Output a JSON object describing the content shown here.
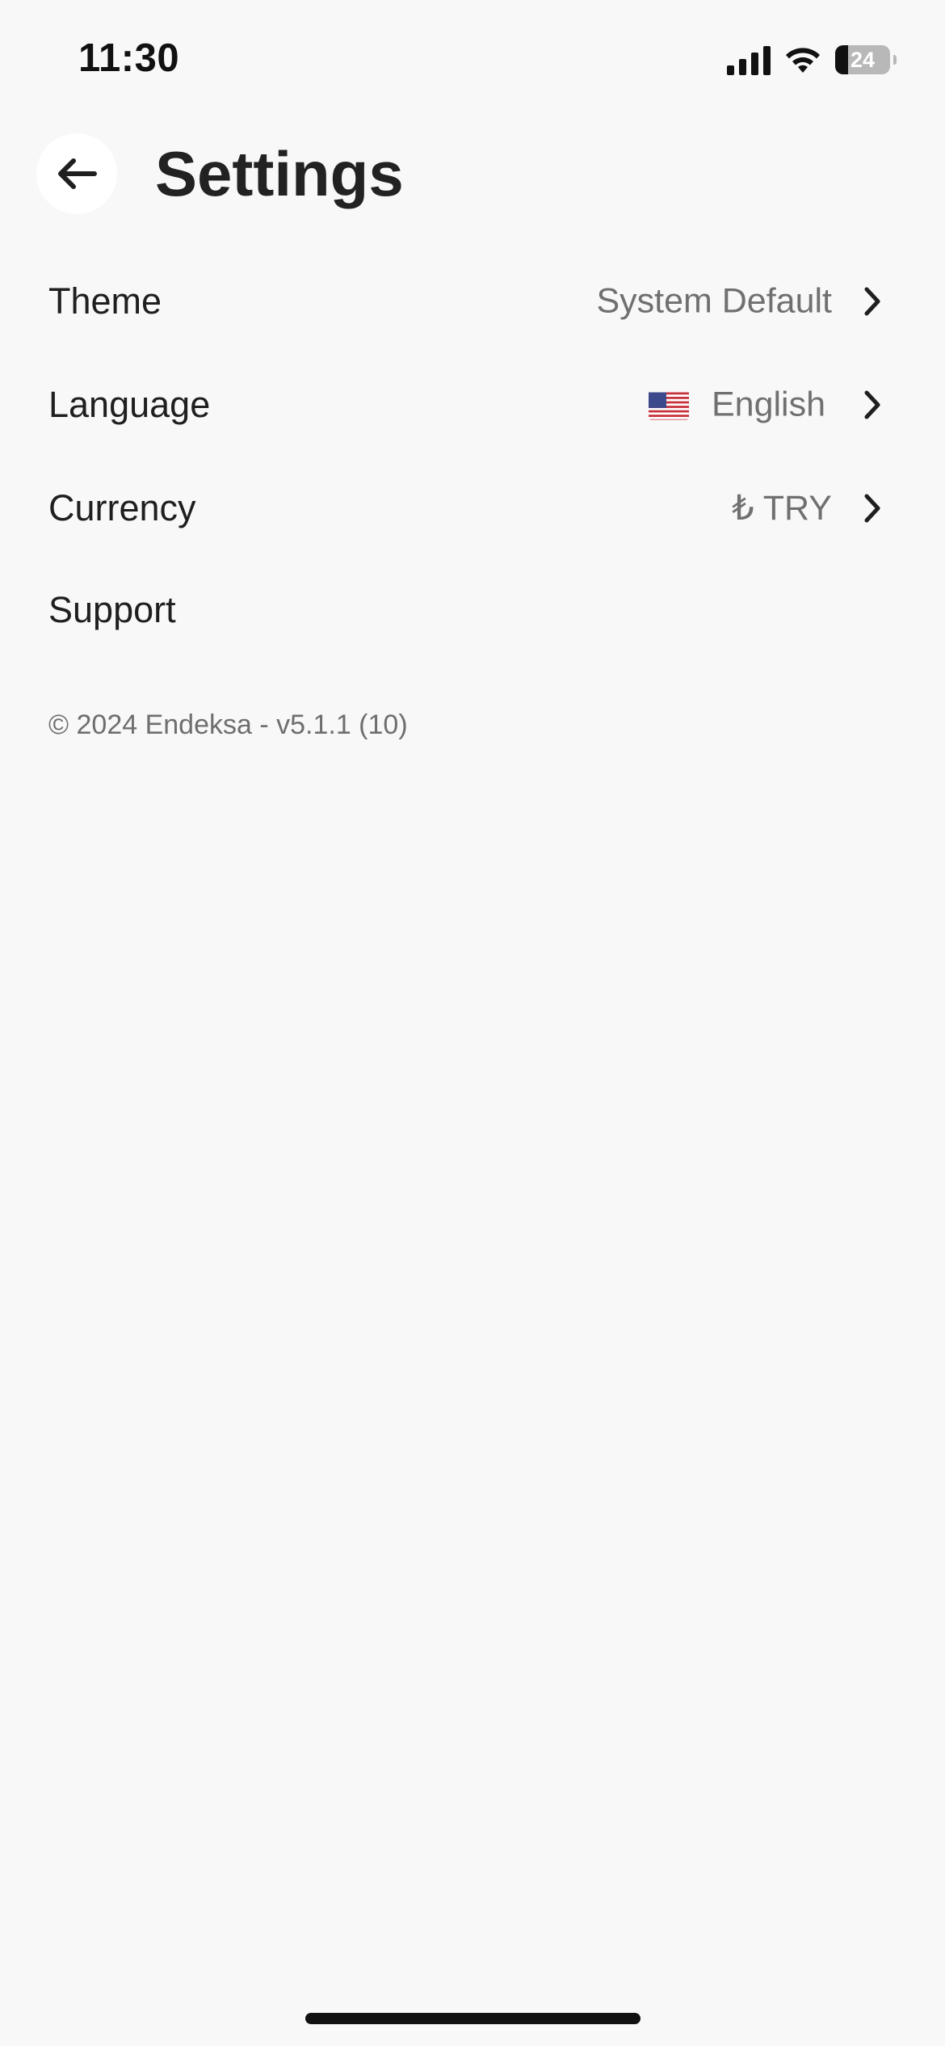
{
  "status_bar": {
    "time": "11:30",
    "battery_level": "24",
    "signal_icon": "cellular-signal-icon",
    "wifi_icon": "wifi-icon",
    "battery_icon": "battery-icon"
  },
  "header": {
    "back_icon": "arrow-left-icon",
    "title": "Settings"
  },
  "settings": {
    "theme": {
      "label": "Theme",
      "value": "System Default",
      "chevron_icon": "chevron-right-icon"
    },
    "language": {
      "label": "Language",
      "flag_icon": "us-flag-icon",
      "value": "English",
      "chevron_icon": "chevron-right-icon"
    },
    "currency": {
      "label": "Currency",
      "value": "₺ TRY",
      "chevron_icon": "chevron-right-icon"
    },
    "support": {
      "label": "Support"
    }
  },
  "footer": {
    "copyright": "© 2024 Endeksa - v5.1.1 (10)"
  },
  "colors": {
    "background": "#f8f8f8",
    "text_primary": "#1f1f1f",
    "text_secondary": "#707070",
    "back_button_bg": "#ffffff"
  }
}
